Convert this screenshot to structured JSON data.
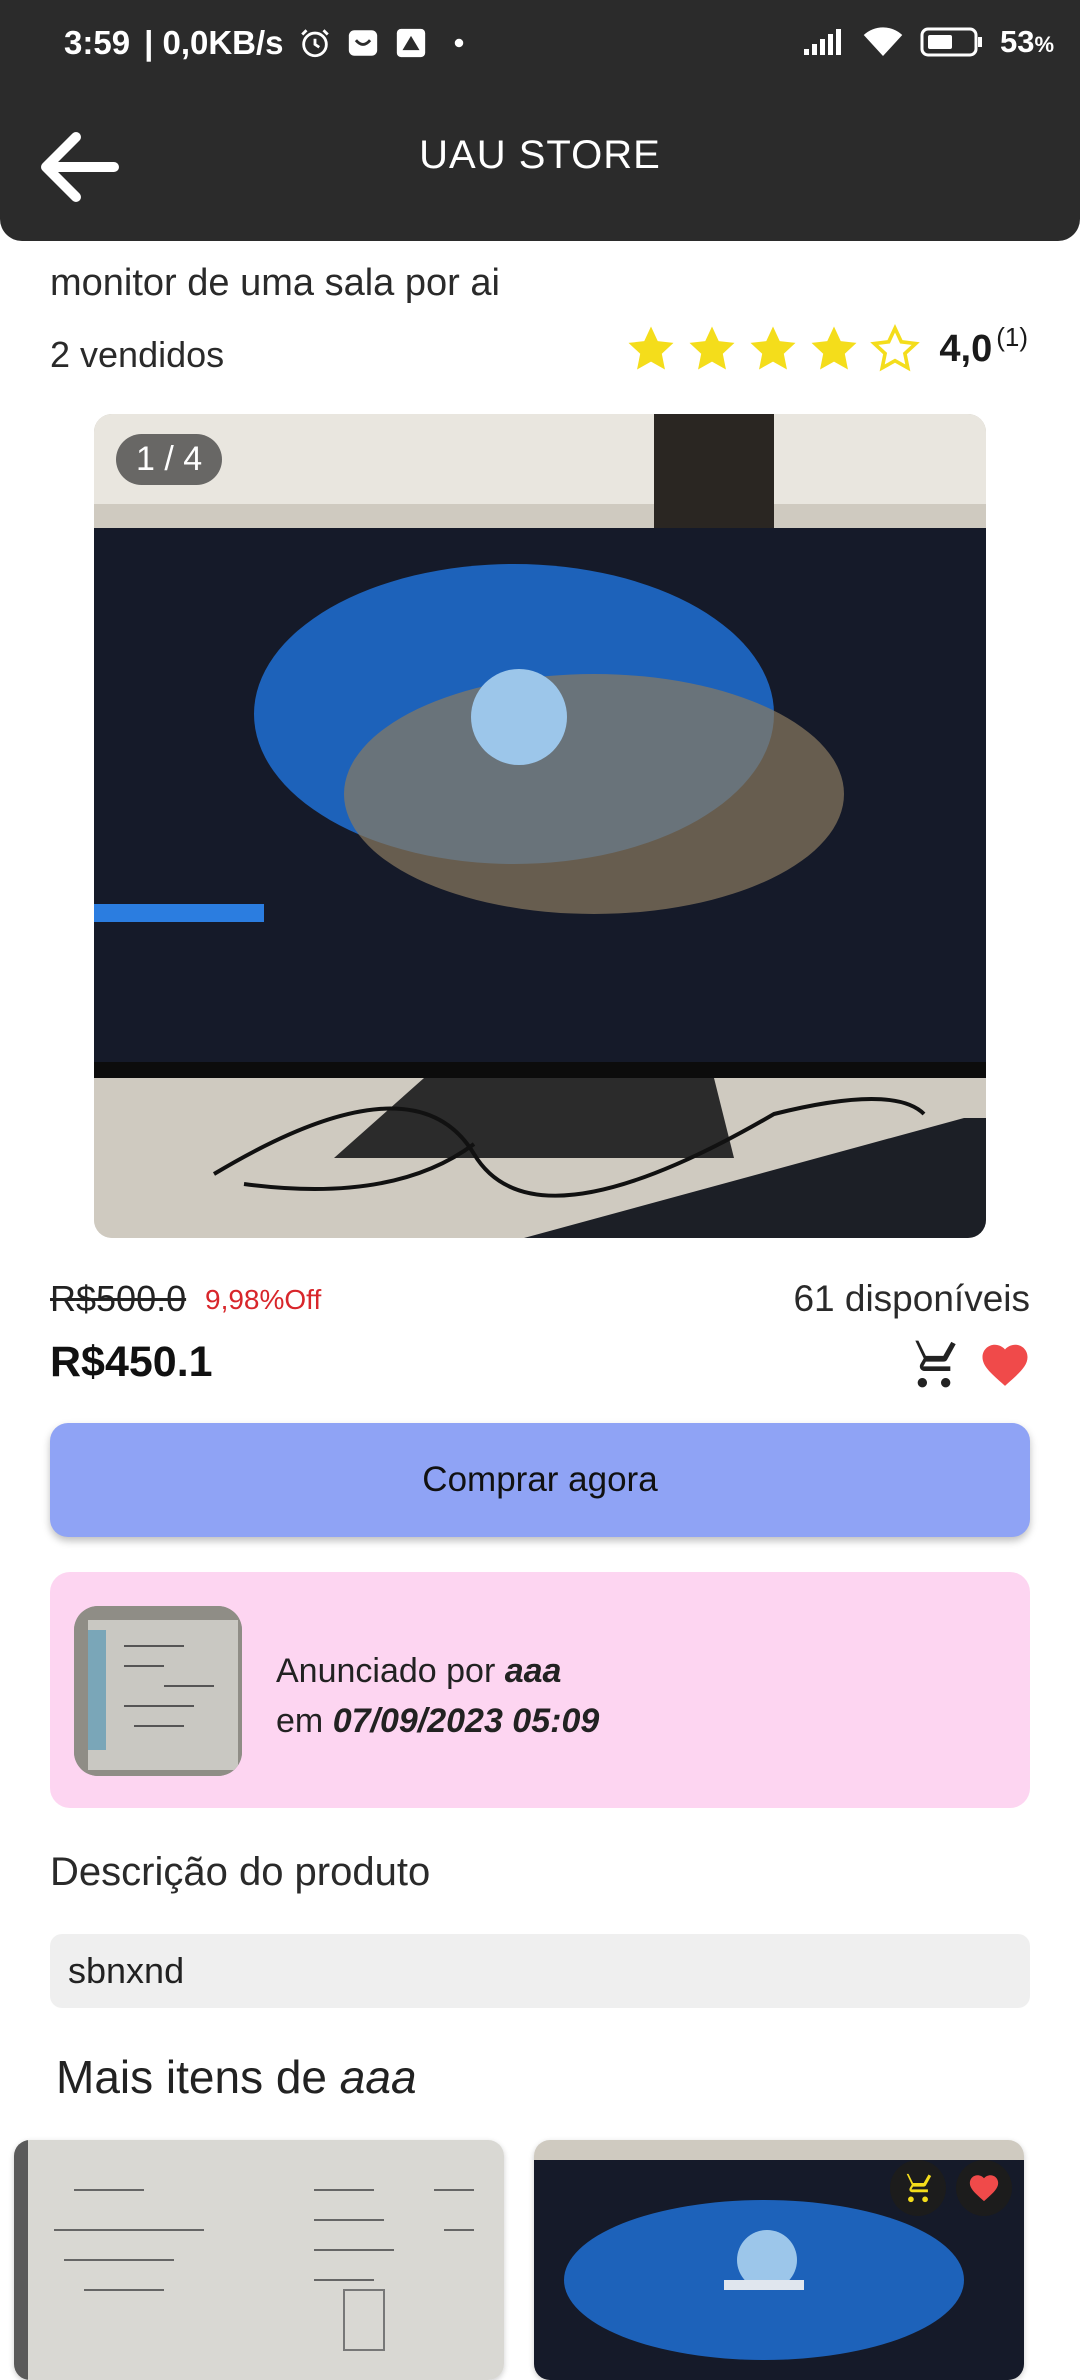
{
  "status_bar": {
    "time": "3:59",
    "network_speed": "| 0,0KB/s",
    "battery_percent": "53",
    "battery_unit": "%",
    "icons": [
      "alarm-icon",
      "notification-icon",
      "app-icon",
      "signal-icon",
      "wifi-icon",
      "battery-icon"
    ]
  },
  "header": {
    "title": "UAU STORE",
    "back_icon": "arrow-left-icon"
  },
  "product": {
    "title": "monitor de uma sala por ai",
    "sold": "2 vendidos",
    "rating_value": "4,0",
    "rating_count": "(1)",
    "stars_filled": 4,
    "stars_total": 5,
    "image_counter": "1 / 4",
    "old_price": "R$500.0",
    "discount": "9,98%Off",
    "stock": "61 disponíveis",
    "price": "R$450.1",
    "buy_label": "Comprar agora"
  },
  "seller": {
    "prefix": "Anunciado por",
    "name": "aaa",
    "date_prefix": "em",
    "date": "07/09/2023 05:09"
  },
  "description": {
    "heading": "Descrição do produto",
    "text": "sbnxnd"
  },
  "more_items": {
    "heading_prefix": "Mais itens de",
    "seller_name": "aaa"
  },
  "colors": {
    "header_bg": "#2b2b2b",
    "star": "#f4dd1b",
    "discount": "#d8262b",
    "buy_button": "#8fa3f5",
    "seller_card": "#fdd5f1",
    "favorite": "#f04a4a"
  }
}
